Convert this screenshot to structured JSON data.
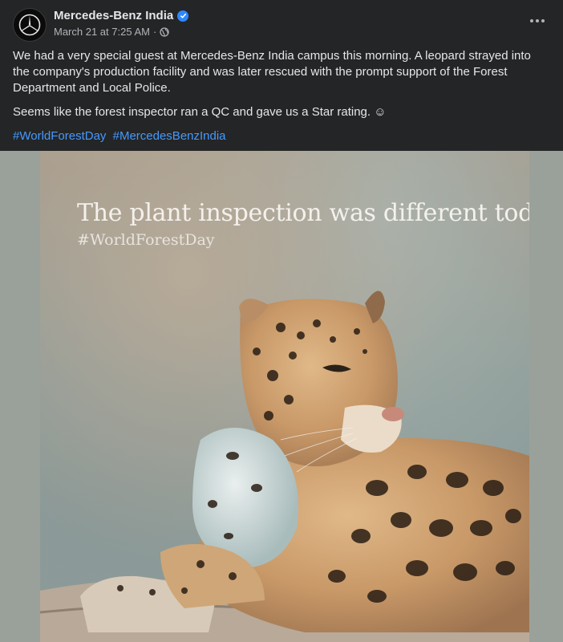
{
  "post": {
    "author": "Mercedes-Benz India",
    "timestamp": "March 21 at 7:25 AM",
    "separator": "·",
    "paragraphs": [
      "We had a very special guest at Mercedes-Benz India campus this morning. A leopard strayed into the company's production facility and was later rescued with the prompt support of the Forest Department and Local Police.",
      "Seems like the forest inspector ran a QC and gave us a Star rating. ☺"
    ],
    "hashtags": [
      "#WorldForestDay",
      "#MercedesBenzIndia"
    ]
  },
  "media": {
    "headline": "The plant inspection was different today.",
    "hashtag": "#WorldForestDay"
  },
  "icons": {
    "avatar": "mercedes-star-logo",
    "verified": "verified-badge-icon",
    "audience": "globe-icon",
    "more": "more-options-icon"
  },
  "colors": {
    "background": "#242526",
    "text": "#e4e6eb",
    "secondary": "#b0b3b8",
    "link": "#4599ff",
    "verified": "#2d88ff"
  }
}
